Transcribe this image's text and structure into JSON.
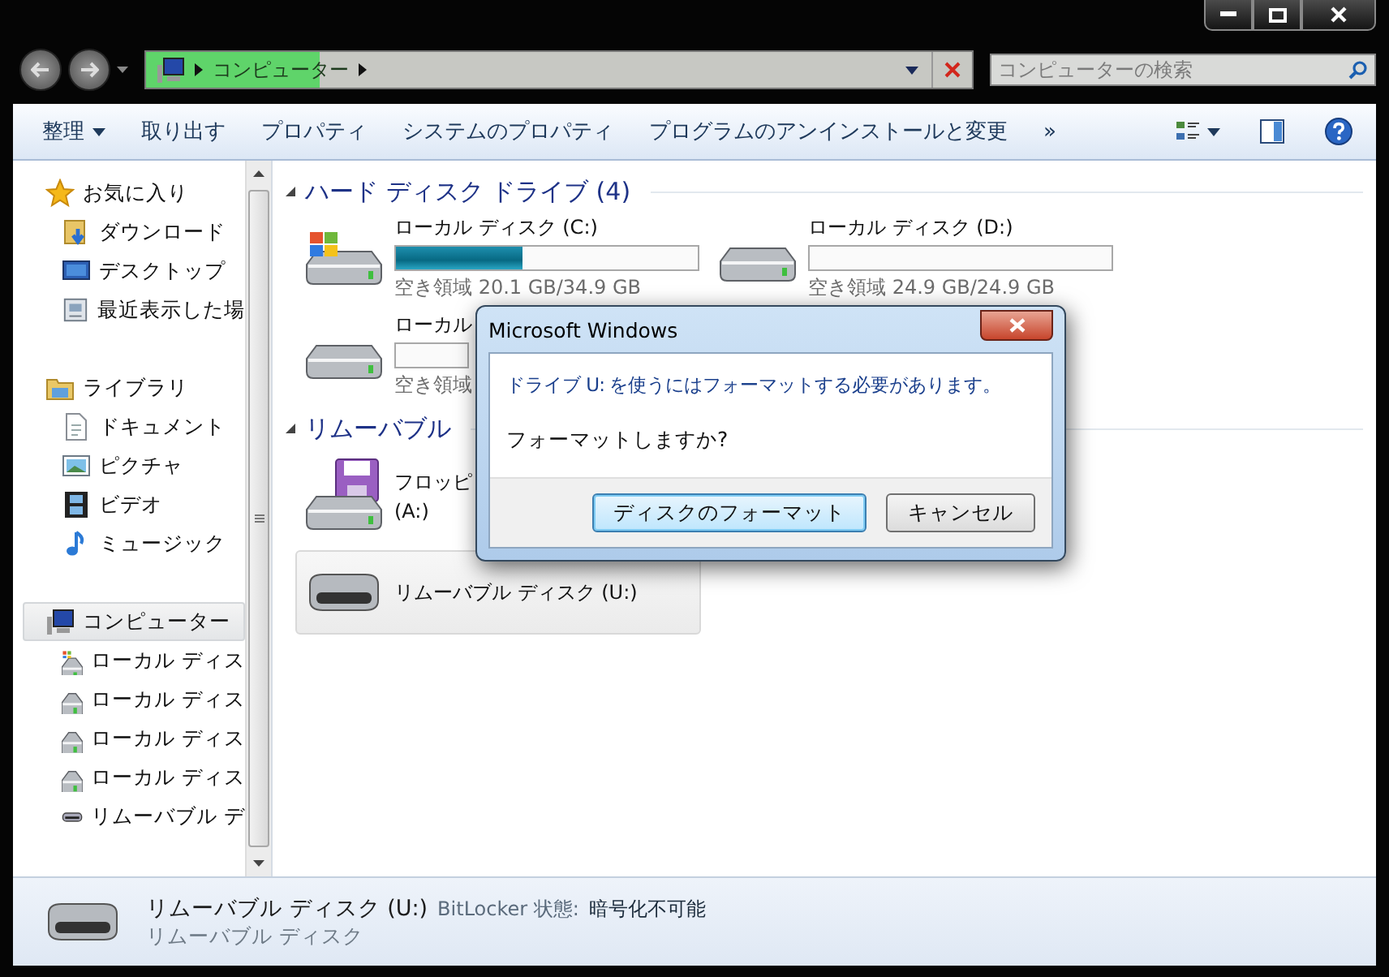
{
  "address_bar": {
    "crumbs": [
      "コンピューター"
    ],
    "level": 0.21
  },
  "search": {
    "placeholder": "コンピューターの検索"
  },
  "toolbar": {
    "items": [
      {
        "label": "整理",
        "dropdown": true
      },
      {
        "label": "取り出す",
        "dropdown": false
      },
      {
        "label": "プロパティ",
        "dropdown": false
      },
      {
        "label": "システムのプロパティ",
        "dropdown": false
      },
      {
        "label": "プログラムのアンインストールと変更",
        "dropdown": false
      }
    ],
    "overflow": "»"
  },
  "sidebar": {
    "groups": [
      {
        "label": "お気に入り",
        "kind": "star",
        "selected": false,
        "children": [
          {
            "label": "ダウンロード",
            "kind": "download"
          },
          {
            "label": "デスクトップ",
            "kind": "desktop"
          },
          {
            "label": "最近表示した場",
            "kind": "recent"
          }
        ]
      },
      {
        "label": "ライブラリ",
        "kind": "library",
        "selected": false,
        "children": [
          {
            "label": "ドキュメント",
            "kind": "document"
          },
          {
            "label": "ピクチャ",
            "kind": "picture"
          },
          {
            "label": "ビデオ",
            "kind": "video"
          },
          {
            "label": "ミュージック",
            "kind": "music"
          }
        ]
      },
      {
        "label": "コンピューター",
        "kind": "computer",
        "selected": true,
        "children": [
          {
            "label": "ローカル ディス",
            "kind": "system"
          },
          {
            "label": "ローカル ディス",
            "kind": "drive"
          },
          {
            "label": "ローカル ディス",
            "kind": "drive"
          },
          {
            "label": "ローカル ディス",
            "kind": "drive"
          },
          {
            "label": "リムーバブル デ",
            "kind": "removable"
          }
        ]
      }
    ]
  },
  "sections": [
    {
      "title": "ハード ディスク ドライブ (4)",
      "items": [
        {
          "kind": "system",
          "name": "ローカル ディスク (C:)",
          "level": 0.42,
          "free": "空き領域 20.1 GB/34.9 GB",
          "selected": false
        },
        {
          "kind": "drive",
          "name": "ローカル ディスク (D:)",
          "level": 0,
          "free": "空き領域 24.9 GB/24.9 GB",
          "selected": false
        },
        {
          "kind": "drive",
          "name": "ローカル",
          "level": 0,
          "free": "空き領域",
          "selected": false
        }
      ]
    },
    {
      "title": "リムーバブル",
      "items": [
        {
          "kind": "floppy",
          "name": "フロッピ",
          "sub": "(A:)",
          "selected": false
        },
        {
          "kind": "removable",
          "name": "リムーバブル ディスク (U:)",
          "selected": true
        }
      ]
    }
  ],
  "dialog": {
    "title": "Microsoft Windows",
    "message": "ドライブ U: を使うにはフォーマットする必要があります。",
    "question": "フォーマットしますか?",
    "buttons": [
      {
        "label": "ディスクのフォーマット",
        "default": true
      },
      {
        "label": "キャンセル",
        "default": false
      }
    ]
  },
  "details": {
    "name": "リムーバブル ディスク (U:)",
    "field_label": "BitLocker 状態:",
    "field_value": "暗号化不可能",
    "type": "リムーバブル ディスク"
  }
}
